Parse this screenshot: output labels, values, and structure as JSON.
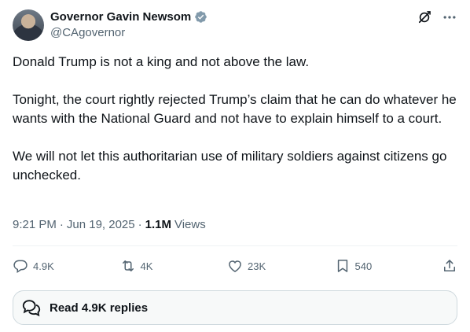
{
  "author": {
    "name": "Governor Gavin Newsom",
    "handle": "@CAgovernor"
  },
  "tweet": {
    "paragraphs": [
      "Donald Trump is not a king and not above the law.",
      "Tonight, the court rightly rejected Trump’s claim that he can do whatever he wants with the National Guard and not have to explain himself to a court.",
      "We will not let this authoritarian use of military soldiers against citizens go unchecked."
    ],
    "time": "9:21 PM",
    "date": "Jun 19, 2025",
    "views_count": "1.1M",
    "views_label": "Views"
  },
  "actions": {
    "replies": "4.9K",
    "reposts": "4K",
    "likes": "23K",
    "bookmarks": "540"
  },
  "read_replies_label": "Read 4.9K replies",
  "colors": {
    "text_primary": "#0f1419",
    "text_secondary": "#536471",
    "verified_badge": "#829aab",
    "border": "#eff3f4"
  },
  "icons": [
    "verified-badge-icon",
    "grok-icon",
    "more-icon",
    "reply-icon",
    "repost-icon",
    "like-icon",
    "bookmark-icon",
    "share-icon",
    "speech-bubbles-icon"
  ]
}
